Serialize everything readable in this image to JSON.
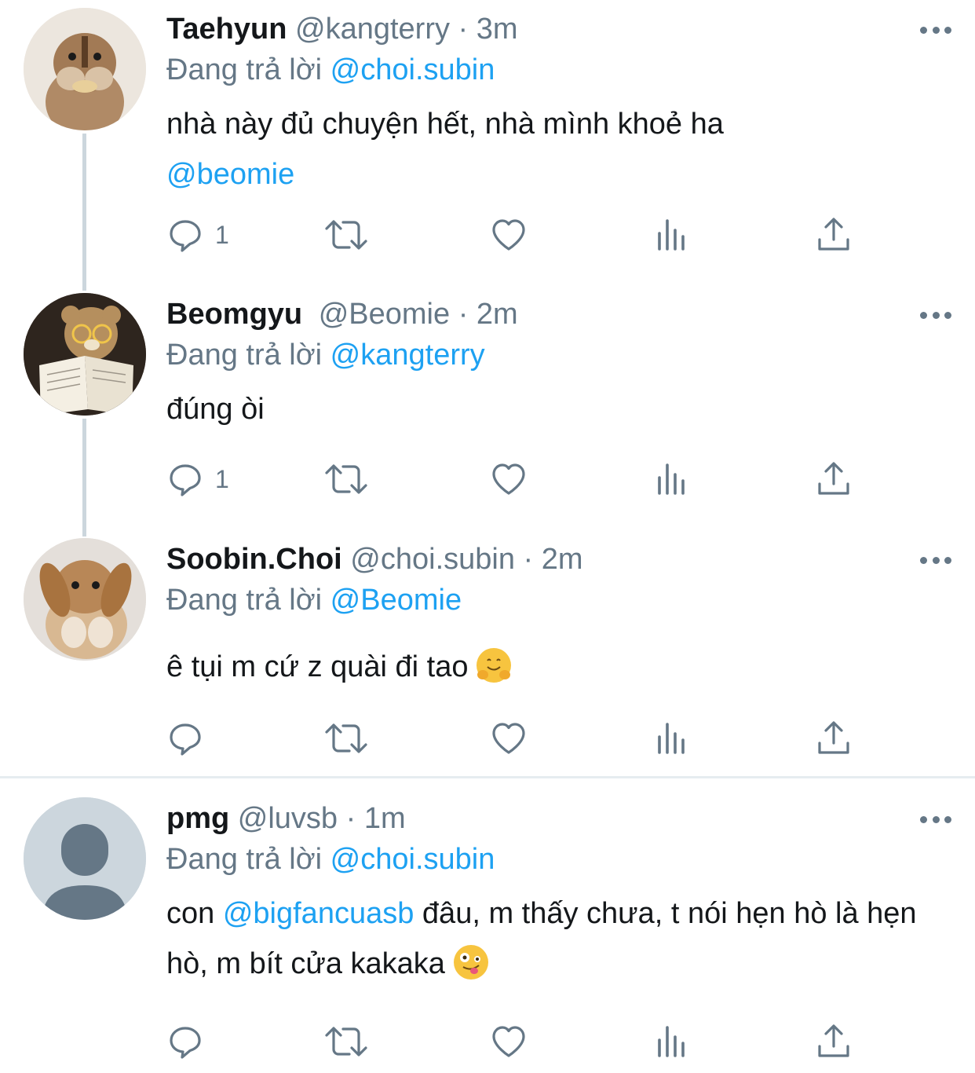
{
  "tweets": [
    {
      "name": "Taehyun",
      "handle": "@kangterry",
      "time": "3m",
      "replying_label": "Đang trả lời",
      "replying_to": "@choi.subin",
      "body_text": "nhà này đủ chuyện hết, nhà mình khoẻ ha",
      "body_mention": "@beomie",
      "reply_count": "1"
    },
    {
      "name": "Beomgyu",
      "handle": "@Beomie",
      "time": "2m",
      "replying_label": "Đang trả lời",
      "replying_to": "@kangterry",
      "body_text": "đúng òi",
      "reply_count": "1"
    },
    {
      "name": "Soobin.Choi",
      "handle": "@choi.subin",
      "time": "2m",
      "replying_label": "Đang trả lời",
      "replying_to": "@Beomie",
      "body_text": "ê tụi m cứ z quài đi tao",
      "emoji": "hugging-face",
      "reply_count": ""
    },
    {
      "name": "pmg",
      "handle": "@luvsb",
      "time": "1m",
      "replying_label": "Đang trả lời",
      "replying_to": "@choi.subin",
      "body_prefix": "con",
      "body_mention": "@bigfancuasb",
      "body_text": "đâu, m thấy chưa, t nói hẹn hò là hẹn hò, m bít cửa kakaka",
      "emoji": "zany-face",
      "reply_count": ""
    }
  ],
  "separator": "·",
  "icons": [
    "reply-icon",
    "retweet-icon",
    "like-icon",
    "analytics-icon",
    "share-icon",
    "more-icon"
  ],
  "colors": {
    "accent": "#1da1f2",
    "secondary": "#657786",
    "text": "#14171a",
    "line": "#ccd6dd"
  }
}
